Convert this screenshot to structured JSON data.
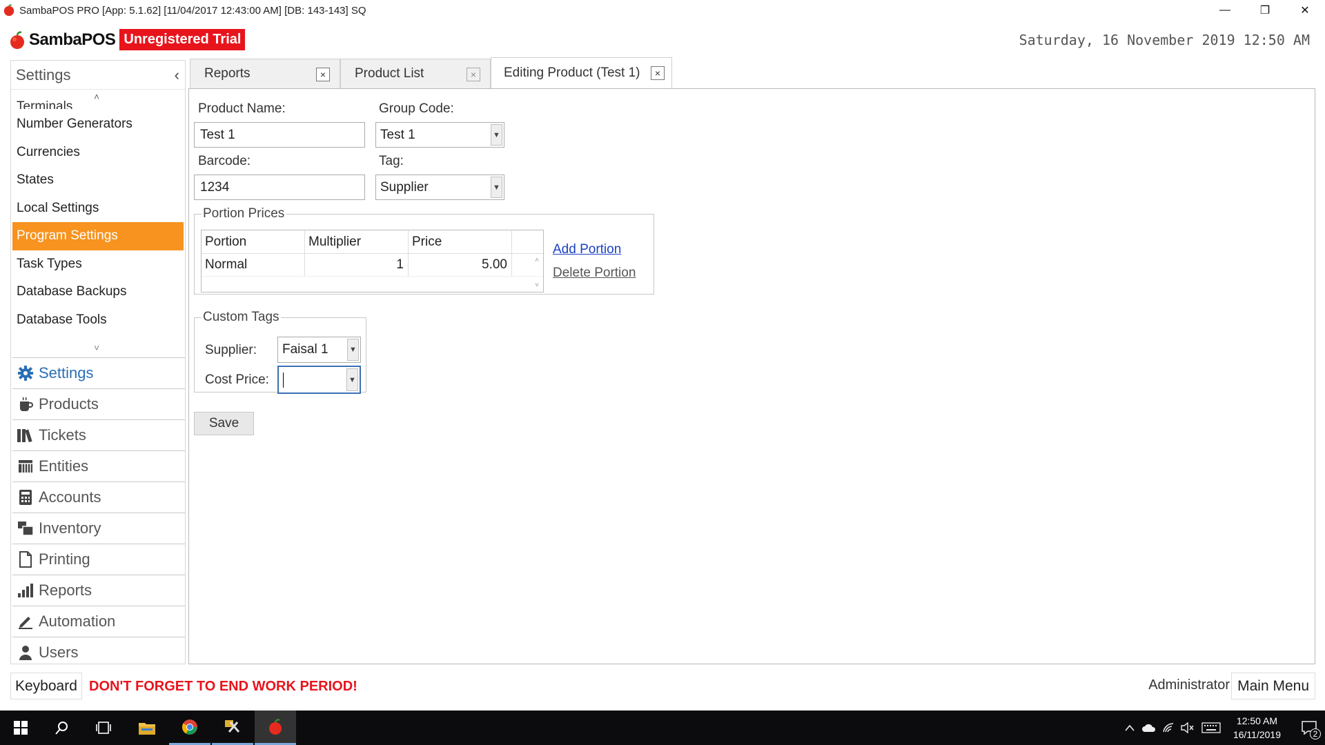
{
  "window": {
    "title": "SambaPOS PRO [App: 5.1.62] [11/04/2017 12:43:00 AM] [DB: 143-143] SQ",
    "minimize_glyph": "—",
    "restore_glyph": "❐",
    "close_glyph": "✕"
  },
  "header": {
    "brand": "SambaPOS",
    "trial_badge": "Unregistered Trial",
    "datetime": "Saturday, 16 November 2019 12:50 AM"
  },
  "sidebar": {
    "title": "Settings",
    "collapse_glyph": "‹",
    "scroll_up_glyph": "˄",
    "scroll_down_glyph": "˅",
    "items": [
      {
        "label": "Terminals"
      },
      {
        "label": "Number Generators"
      },
      {
        "label": "Currencies"
      },
      {
        "label": "States"
      },
      {
        "label": "Local Settings"
      },
      {
        "label": "Program Settings"
      },
      {
        "label": "Task Types"
      },
      {
        "label": "Database Backups"
      },
      {
        "label": "Database Tools"
      }
    ],
    "nav": [
      {
        "label": "Settings",
        "icon": "gear-icon"
      },
      {
        "label": "Products",
        "icon": "coffee-cup-icon"
      },
      {
        "label": "Tickets",
        "icon": "books-icon"
      },
      {
        "label": "Entities",
        "icon": "grid-icon"
      },
      {
        "label": "Accounts",
        "icon": "calculator-icon"
      },
      {
        "label": "Inventory",
        "icon": "inventory-icon"
      },
      {
        "label": "Printing",
        "icon": "document-icon"
      },
      {
        "label": "Reports",
        "icon": "bar-chart-icon"
      },
      {
        "label": "Automation",
        "icon": "pen-icon"
      },
      {
        "label": "Users",
        "icon": "user-icon"
      }
    ]
  },
  "tabs": [
    {
      "label": "Reports",
      "close": "×"
    },
    {
      "label": "Product List",
      "close": "×"
    },
    {
      "label": "Editing Product (Test 1)",
      "close": "×"
    }
  ],
  "form": {
    "product_name_label": "Product Name:",
    "product_name_value": "Test 1",
    "group_code_label": "Group Code:",
    "group_code_value": "Test 1",
    "barcode_label": "Barcode:",
    "barcode_value": "1234",
    "tag_label": "Tag:",
    "tag_value": "Supplier",
    "dropdown_glyph": "▼"
  },
  "portion_prices": {
    "legend": "Portion Prices",
    "columns": [
      "Portion",
      "Multiplier",
      "Price"
    ],
    "rows": [
      {
        "portion": "Normal",
        "multiplier": "1",
        "price": "5.00"
      }
    ],
    "add_link": "Add Portion",
    "delete_link": "Delete Portion",
    "scroll_up_glyph": "˄",
    "scroll_down_glyph": "˅"
  },
  "custom_tags": {
    "legend": "Custom Tags",
    "supplier_label": "Supplier:",
    "supplier_value": "Faisal 1",
    "cost_price_label": "Cost Price:",
    "cost_price_value": ""
  },
  "save_label": "Save",
  "footer": {
    "keyboard_label": "Keyboard",
    "warning": "DON'T FORGET TO END WORK PERIOD!",
    "user": "Administrator",
    "main_menu_label": "Main Menu"
  },
  "taskbar": {
    "time": "12:50 AM",
    "date": "16/11/2019",
    "notification_count": "2"
  },
  "colors": {
    "accent_orange": "#f7931e",
    "trial_red": "#e8141c",
    "link_blue": "#1a3fc4",
    "settings_blue": "#2a6fb5"
  }
}
